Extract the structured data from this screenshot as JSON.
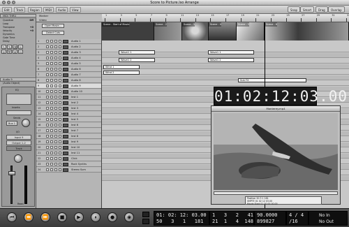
{
  "window": {
    "title": "Score to Picture.lso Arrange"
  },
  "toolbar": {
    "menus": [
      "Edit",
      "Track",
      "Region",
      "MIDI",
      "Audio",
      "View"
    ],
    "right_buttons": [
      "Snap",
      "Smart",
      "Drag",
      "Overlap"
    ]
  },
  "inspector": {
    "header": "MIDI THRU",
    "params": [
      {
        "label": "Quantize",
        "value": "Off"
      },
      {
        "label": "Loop",
        "value": ""
      },
      {
        "label": "Transpose",
        "value": "+0"
      },
      {
        "label": "Velocity",
        "value": "+0"
      },
      {
        "label": "Dynamics",
        "value": ""
      },
      {
        "label": "Gate Time",
        "value": ""
      },
      {
        "label": "Delay",
        "value": ""
      }
    ],
    "track_section": "Audio 9",
    "track_sub": "(Audio Object)",
    "eq_label": "EQ",
    "inserts_label": "Inserts",
    "sends_label": "Sends",
    "bus_label": "Bus 1",
    "io_label": "I/O",
    "input_label": "Input 9",
    "output_label": "Output 1-2",
    "track_button": "Track",
    "read_label": "Read",
    "tools": [
      "↖",
      "✎",
      "⌫",
      "✂",
      "◎",
      "M",
      "⊕",
      "↔"
    ]
  },
  "track_header": {
    "global_rows": [
      "Marker",
      "Video"
    ],
    "open_movie": "Open Movie...",
    "detect_cuts": "Detect Cuts"
  },
  "tracks": [
    {
      "num": "1",
      "name": "Audio 1"
    },
    {
      "num": "2",
      "name": "Audio 2"
    },
    {
      "num": "3",
      "name": "Audio 3"
    },
    {
      "num": "4",
      "name": "Audio 4"
    },
    {
      "num": "5",
      "name": "Audio 5"
    },
    {
      "num": "6",
      "name": "Audio 6"
    },
    {
      "num": "7",
      "name": "Audio 7"
    },
    {
      "num": "8",
      "name": "Audio 8"
    },
    {
      "num": "9",
      "name": "Audio 9"
    },
    {
      "num": "10",
      "name": "Audio 10"
    },
    {
      "num": "11",
      "name": "Inst 1"
    },
    {
      "num": "12",
      "name": "Inst 2"
    },
    {
      "num": "13",
      "name": "Inst 3"
    },
    {
      "num": "14",
      "name": "Inst 4"
    },
    {
      "num": "15",
      "name": "Inst 5"
    },
    {
      "num": "16",
      "name": "Inst 6"
    },
    {
      "num": "17",
      "name": "Inst 7"
    },
    {
      "num": "18",
      "name": "Inst 8"
    },
    {
      "num": "19",
      "name": "Inst 9"
    },
    {
      "num": "20",
      "name": "Inst 10"
    },
    {
      "num": "21",
      "name": "Inst 11"
    },
    {
      "num": "22",
      "name": "Click"
    },
    {
      "num": "23",
      "name": "Rock Synths"
    },
    {
      "num": "24",
      "name": "Stereo Sum"
    }
  ],
  "selected_track_index": 8,
  "ruler": {
    "bars": [
      "1",
      "3",
      "5",
      "7",
      "9",
      "11",
      "13",
      "15",
      "17",
      "19",
      "21",
      "23",
      "25",
      "27",
      "29",
      "31",
      "33"
    ]
  },
  "video_thumbs": [
    {
      "label": "Scene - Start of Movie"
    },
    {
      "label": "Scene - 2"
    },
    {
      "label": "Scene - 3"
    },
    {
      "label": "Scene - 4"
    },
    {
      "label": "Scene - 5"
    },
    {
      "label": "Scene - 6"
    }
  ],
  "regions": [
    {
      "label": "Wave1 1",
      "lane": 0
    },
    {
      "label": "Wave1 1",
      "lane": 0
    },
    {
      "label": "Wave1 2",
      "lane": 1
    },
    {
      "label": "Wave1 2",
      "lane": 1
    },
    {
      "label": "Wind 1",
      "lane": 2
    },
    {
      "label": "Wind 2",
      "lane": 3
    },
    {
      "label": "Sub FX",
      "lane": 5
    }
  ],
  "big_clock": "01:02:12:03.00",
  "movie_window": {
    "title": "Monterey.mp4",
    "rows": [
      {
        "label": "Position",
        "value": "50  3  1  181"
      },
      {
        "label": "SMPTE",
        "value": "01 02 12 03.00"
      },
      {
        "label": "Movie Start",
        "value": "01 00 00 00.00"
      }
    ]
  },
  "transport": {
    "buttons": [
      "⏮",
      "⏪",
      "⏩",
      "■",
      "▶",
      "⏸",
      "●",
      "◉"
    ],
    "smpte_line1": "01: 02: 12: 03.00",
    "smpte_line2": "50   3   1   181",
    "bars_line1": "1   3   2   41",
    "bars_line2": "21  1   4  148",
    "tempo_line1": "90.0000",
    "tempo_line2": "899827",
    "sig_line1": "4 / 4",
    "sig_line2": "/16",
    "in_label": "No In",
    "out_label": "No Out"
  }
}
